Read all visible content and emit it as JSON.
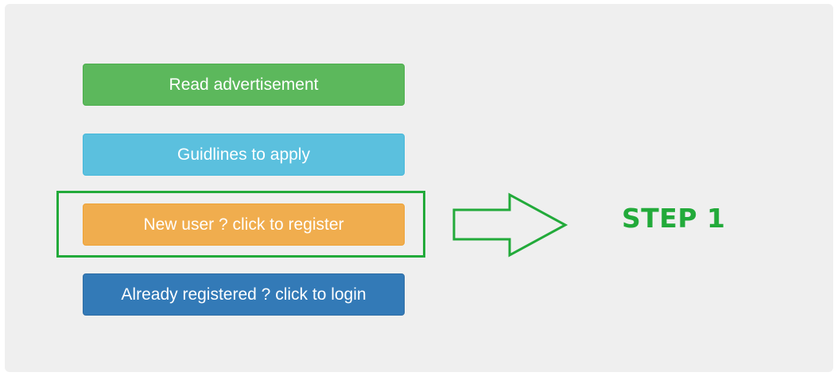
{
  "buttons": {
    "read_advertisement": "Read advertisement",
    "guidelines": "Guidlines to apply",
    "register": "New user ? click to register",
    "login": "Already registered ? click to login"
  },
  "annotation": {
    "step_label": "STEP 1",
    "color": "#22aa3a",
    "arrow_icon": "right-arrow-outline-icon"
  },
  "colors": {
    "green_button": "#5cb85c",
    "cyan_button": "#5bc0de",
    "orange_button": "#f0ad4e",
    "blue_button": "#337ab7",
    "panel_background": "#efefef"
  }
}
